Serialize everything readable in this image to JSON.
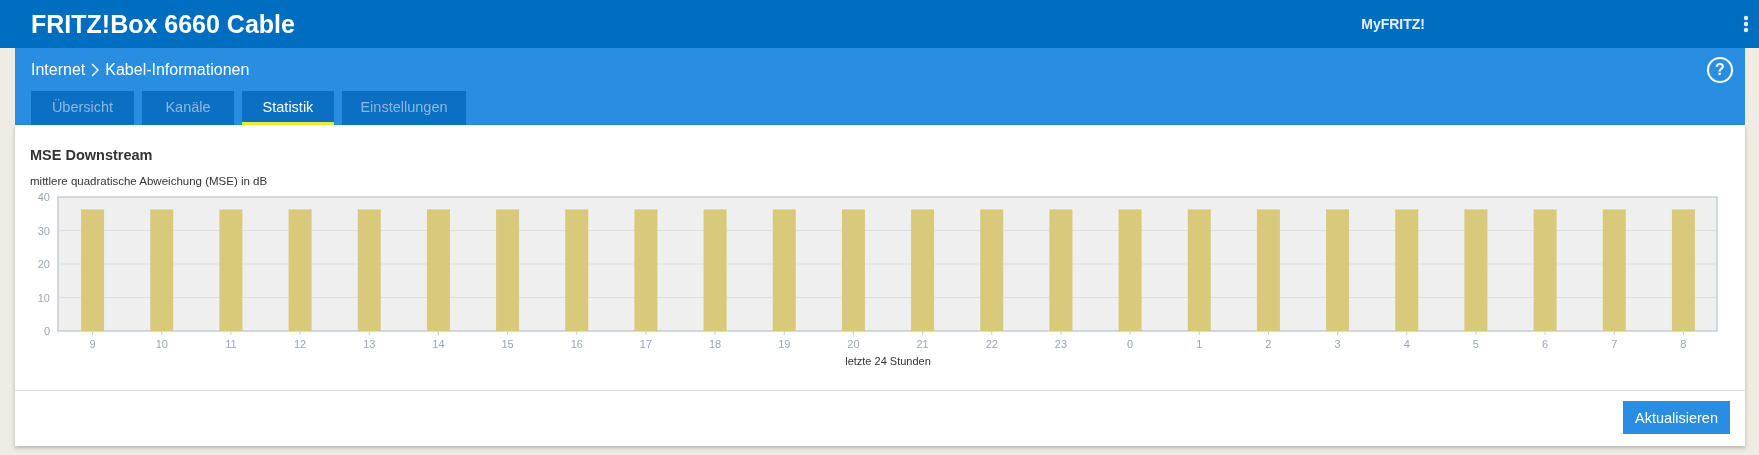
{
  "header": {
    "title": "FRITZ!Box 6660 Cable",
    "myfritz_link": "MyFRITZ!"
  },
  "breadcrumb": [
    "Internet",
    "Kabel-Informationen"
  ],
  "help_icon": "?",
  "tabs": [
    {
      "label": "Übersicht",
      "selected": false
    },
    {
      "label": "Kanäle",
      "selected": false
    },
    {
      "label": "Statistik",
      "selected": true
    },
    {
      "label": "Einstellungen",
      "selected": false
    }
  ],
  "section": {
    "title": "MSE Downstream",
    "chart_data": {
      "type": "bar",
      "ylabel": "mittlere quadratische Abweichung (MSE) in dB",
      "xlabel": "letzte 24 Stunden",
      "categories": [
        "9",
        "10",
        "11",
        "12",
        "13",
        "14",
        "15",
        "16",
        "17",
        "18",
        "19",
        "20",
        "21",
        "22",
        "23",
        "0",
        "1",
        "2",
        "3",
        "4",
        "5",
        "6",
        "7",
        "8"
      ],
      "series": [
        {
          "color": "#d9c97b",
          "values": [
            36.3,
            36.3,
            36.3,
            36.3,
            36.3,
            36.3,
            36.3,
            36.3,
            36.3,
            36.3,
            36.3,
            36.3,
            36.3,
            36.3,
            36.3,
            36.3,
            36.3,
            36.3,
            36.3,
            36.3,
            36.3,
            36.3,
            36.3,
            36.3
          ]
        }
      ],
      "grid": true,
      "ylim": [
        0,
        40
      ],
      "yticks": [
        0,
        10,
        20,
        30,
        40
      ]
    }
  },
  "buttons": [
    "Aktualisieren"
  ]
}
